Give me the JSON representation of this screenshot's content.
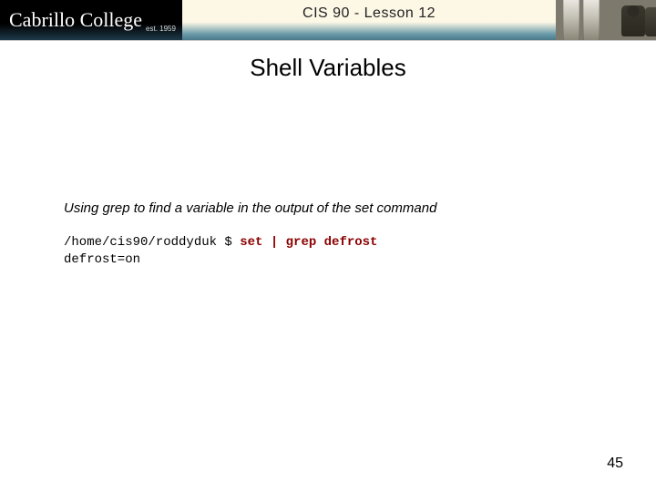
{
  "banner": {
    "logo_text": "Cabrillo College",
    "est_text": "est. 1959",
    "course_label": "CIS 90 - Lesson 12"
  },
  "slide": {
    "title": "Shell Variables",
    "caption": "Using grep to find a variable in the output of the set command",
    "terminal": {
      "prompt": "/home/cis90/roddyduk $ ",
      "command": "set | grep defrost",
      "output": "defrost=on"
    }
  },
  "page_number": "45"
}
